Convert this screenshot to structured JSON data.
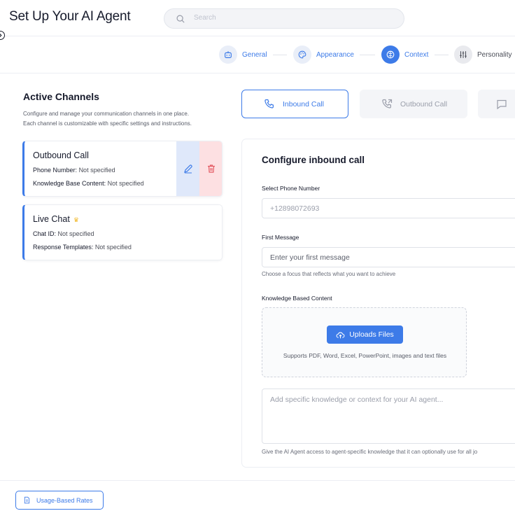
{
  "header": {
    "title": "Set Up Your AI Agent",
    "search_placeholder": "Search"
  },
  "stepper": {
    "steps": [
      {
        "label": "General",
        "icon": "robot-icon",
        "state": "completed"
      },
      {
        "label": "Appearance",
        "icon": "palette-icon",
        "state": "completed"
      },
      {
        "label": "Context",
        "icon": "brain-icon",
        "state": "active"
      },
      {
        "label": "Personality",
        "icon": "sliders-icon",
        "state": "upcoming"
      }
    ]
  },
  "channels": {
    "title": "Active Channels",
    "description_line1": "Configure and manage your communication channels in one place.",
    "description_line2": "Each channel is customizable with specific settings and instructions.",
    "cards": [
      {
        "title": "Outbound Call",
        "rows": [
          {
            "label": "Phone Number:",
            "value": "Not specified"
          },
          {
            "label": "Knowledge Base Content:",
            "value": "Not specified"
          }
        ]
      },
      {
        "title": "Live Chat",
        "badge_icon": "crown-icon",
        "rows": [
          {
            "label": "Chat ID:",
            "value": "Not specified"
          },
          {
            "label": "Response Templates:",
            "value": "Not specified"
          }
        ]
      }
    ]
  },
  "tabs": [
    {
      "label": "Inbound Call",
      "icon": "phone-icon",
      "active": true
    },
    {
      "label": "Outbound Call",
      "icon": "phone-outgoing-icon",
      "active": false
    },
    {
      "label": "",
      "icon": "chat-icon",
      "active": false
    }
  ],
  "config": {
    "title": "Configure inbound call",
    "phone_label": "Select Phone Number",
    "phone_value": "+12898072693",
    "first_message_label": "First Message",
    "first_message_placeholder": "Enter your first message",
    "first_message_hint": "Choose a focus that reflects what you want to achieve",
    "knowledge_label": "Knowledge Based Content",
    "upload_label": "Uploads Files",
    "upload_hint": "Supports PDF, Word, Excel, PowerPoint, images and text files",
    "context_placeholder": "Add specific knowledge or context for your AI agent...",
    "context_hint": "Give the AI Agent access to agent-specific knowledge that it can optionally use for all jo"
  },
  "footer": {
    "rates_label": "Usage-Based Rates"
  },
  "colors": {
    "accent": "#3d7be8",
    "delete_bg": "#fde0e2",
    "edit_bg": "#dfe8fa",
    "crown": "#f1b829"
  }
}
